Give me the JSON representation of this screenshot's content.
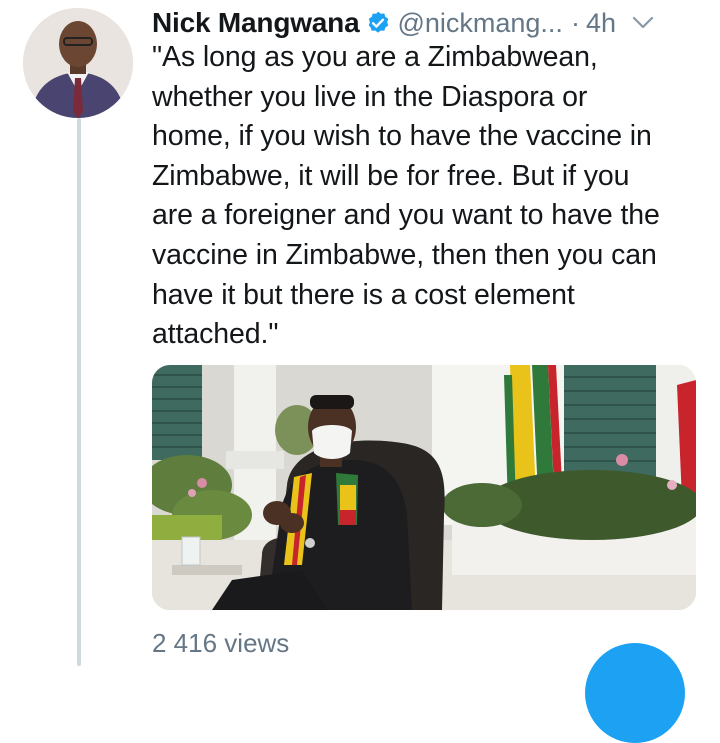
{
  "tweet": {
    "author_name": "Nick Mangwana",
    "handle": "@nickmang...",
    "separator": "·",
    "time": "4h",
    "text": "\"As long as you are a Zimbabwean,\nwhether you live in the Diaspora or\nhome, if you wish to have the vaccine in\nZimbabwe, it will be for free. But if you\nare a foreigner and you want to have the\nvaccine in Zimbabwe, then then you can\nhave it but there is a cost element\nattached.\"",
    "views": "2 416 views"
  },
  "icons": {
    "verified": "verified-badge-icon",
    "menu": "chevron-down-icon"
  },
  "colors": {
    "accent": "#1da1f2",
    "secondary_text": "#657786",
    "primary_text": "#14171a"
  }
}
